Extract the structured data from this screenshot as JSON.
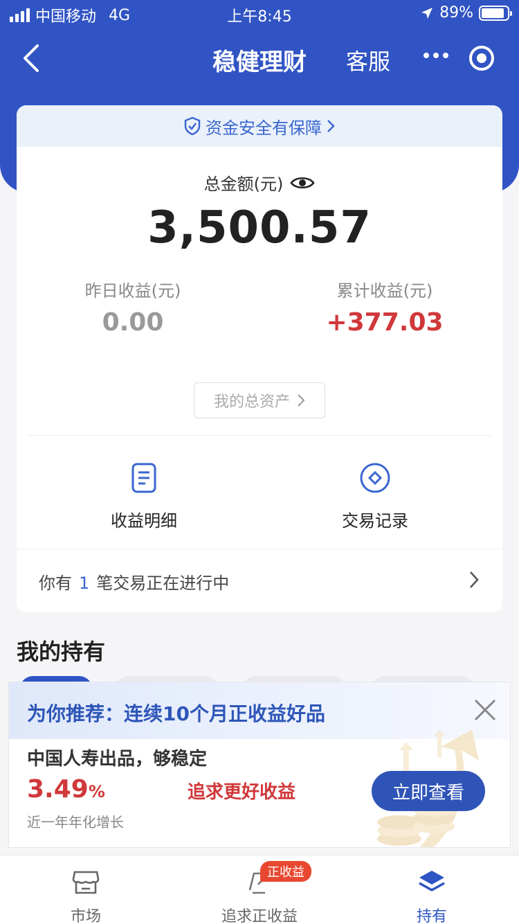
{
  "status_bar": {
    "carrier": "中国移动",
    "network": "4G",
    "time": "上午8:45",
    "battery": "89%",
    "battery_level": 0.89
  },
  "nav": {
    "title": "稳健理财",
    "service": "客服"
  },
  "card": {
    "security_banner": "资金安全有保障",
    "total_label": "总金额(元)",
    "total_amount": "3,500.57",
    "yesterday_label": "昨日收益(元)",
    "yesterday_value": "0.00",
    "cumulative_label": "累计收益(元)",
    "cumulative_value": "+377.03",
    "total_assets_button": "我的总资产",
    "quick_actions": [
      {
        "label": "收益明细",
        "icon": "document-icon"
      },
      {
        "label": "交易记录",
        "icon": "diamond-circle-icon"
      }
    ],
    "pending": {
      "prefix": "你有",
      "count": "1",
      "suffix": "笔交易正在进行中"
    }
  },
  "holdings": {
    "title": "我的持有"
  },
  "recommend": {
    "title": "为你推荐：连续10个月正收益好品",
    "subtitle": "中国人寿出品，够稳定",
    "rate": "3.49",
    "rate_unit": "%",
    "rate_label": "近一年年化增长",
    "slogan": "追求更好收益",
    "button": "立即查看"
  },
  "tabbar": {
    "items": [
      {
        "label": "市场",
        "icon": "store-icon"
      },
      {
        "label": "追求正收益",
        "icon": "growth-icon"
      },
      {
        "label": "持有",
        "icon": "layers-icon"
      }
    ],
    "badge": "正收益",
    "active_color": "#2f54c4"
  },
  "colors": {
    "brand_blue": "#3154c4",
    "profit_red": "#d0383a"
  }
}
